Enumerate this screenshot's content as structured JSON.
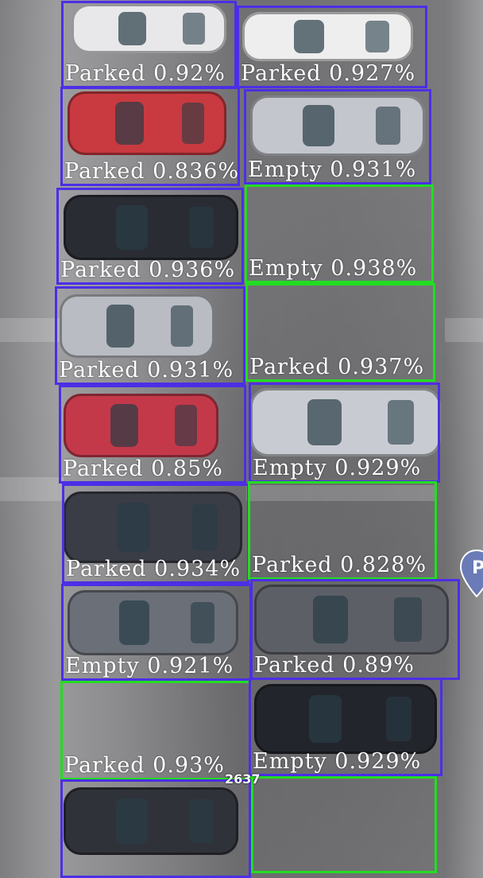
{
  "detections": [
    {
      "label": "Parked 0.92%"
    },
    {
      "label": "Parked 0.927%"
    },
    {
      "label": "Parked 0.836%"
    },
    {
      "label": "Empty 0.931%"
    },
    {
      "label": "Parked 0.936%"
    },
    {
      "label": "Empty 0.938%"
    },
    {
      "label": "Parked 0.931%"
    },
    {
      "label": "Parked 0.937%"
    },
    {
      "label": "Parked 0.85%"
    },
    {
      "label": "Empty 0.929%"
    },
    {
      "label": "Parked 0.934%"
    },
    {
      "label": "Parked 0.828%"
    },
    {
      "label": "Empty 0.921%"
    },
    {
      "label": "Parked 0.89%"
    },
    {
      "label": "Parked 0.93%"
    },
    {
      "label": "Empty 0.929%"
    },
    {
      "label": ""
    },
    {
      "label": ""
    }
  ],
  "overlay_text": "2637",
  "map_pin_letter": "P",
  "colors": {
    "box_blue": "#4b2fe6",
    "box_green": "#22dd22",
    "label_text": "#ffffff",
    "pin": "#6a7bb8"
  }
}
